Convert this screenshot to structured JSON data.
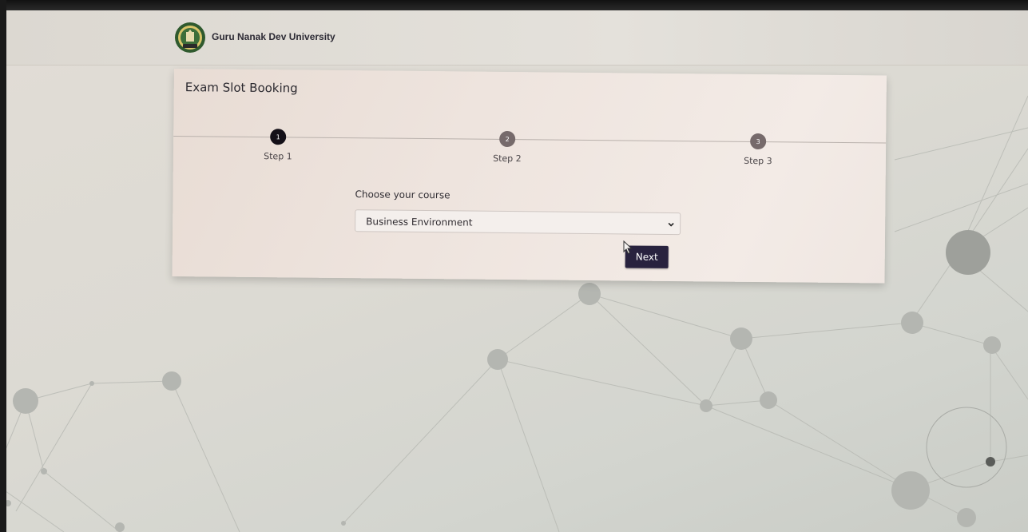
{
  "app": {
    "name": "Guru Nanak Dev University",
    "logo_icon": "university-emblem-icon"
  },
  "page": {
    "title": "Exam Slot Booking"
  },
  "stepper": {
    "steps": [
      {
        "number": "1",
        "label": "Step 1",
        "state": "active"
      },
      {
        "number": "2",
        "label": "Step 2",
        "state": "inactive"
      },
      {
        "number": "3",
        "label": "Step 3",
        "state": "inactive"
      }
    ]
  },
  "form": {
    "course_label": "Choose your course",
    "course_selected": "Business Environment",
    "next_label": "Next"
  },
  "colors": {
    "accent": "#28223e",
    "step_active": "#141018",
    "step_inactive": "#766a6b"
  }
}
